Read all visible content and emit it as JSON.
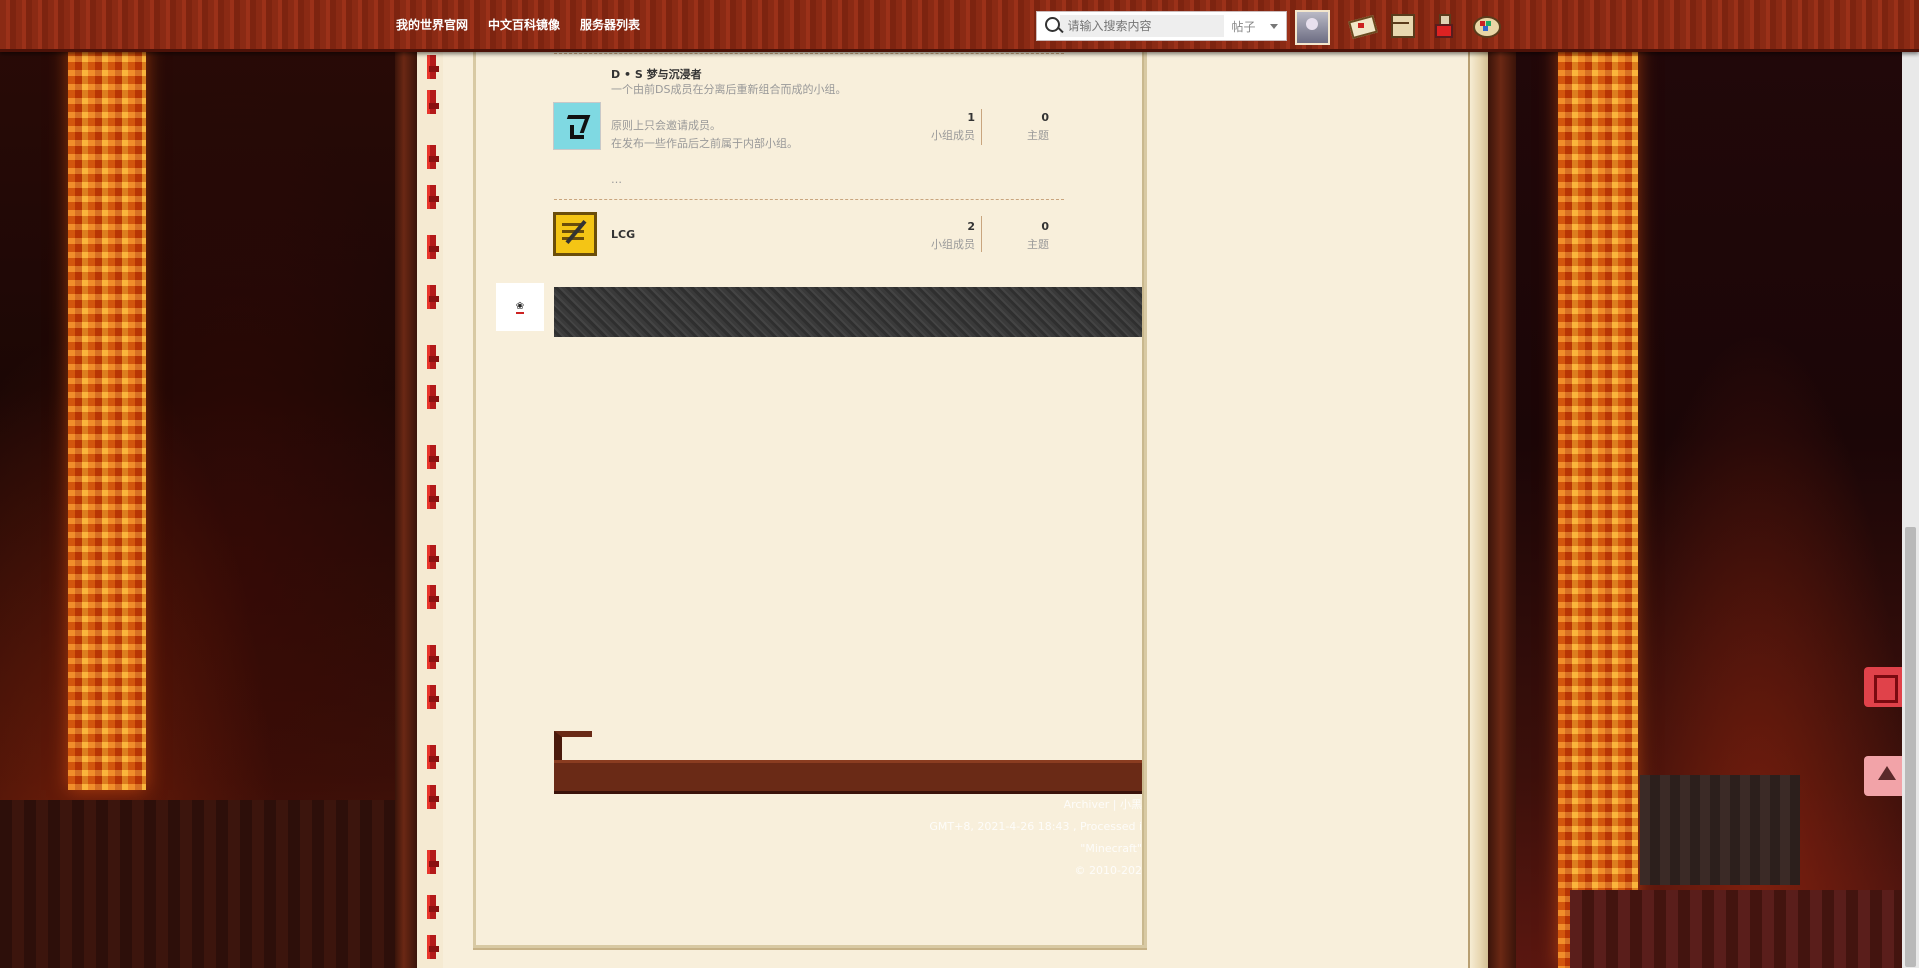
{
  "topbar": {
    "nav": [
      "我的世界官网",
      "中文百科镜像",
      "服务器列表"
    ],
    "search_placeholder": "请输入搜索内容",
    "search_scope": "帖子"
  },
  "groups": [
    {
      "name": "D • S 梦与沉浸者",
      "description": "一个由前DS成员在分离后重新组合而成的小组。",
      "notes": [
        "原则上只会邀请成员。",
        "在发布一些作品后之前属于内部小组。",
        "…"
      ],
      "members": "1",
      "members_label": "小组成员",
      "topics": "0",
      "topics_label": "主题"
    },
    {
      "name": "LCG",
      "members": "2",
      "members_label": "小组成员",
      "topics": "0",
      "topics_label": "主题"
    }
  ],
  "footer": {
    "links": [
      "Archiver",
      "|",
      "小黑"
    ],
    "line1": "GMT+8, 2021-4-26 18:43 , Processed i",
    "line2": "\"Minecraft\"",
    "line3": "© 2010-202"
  }
}
